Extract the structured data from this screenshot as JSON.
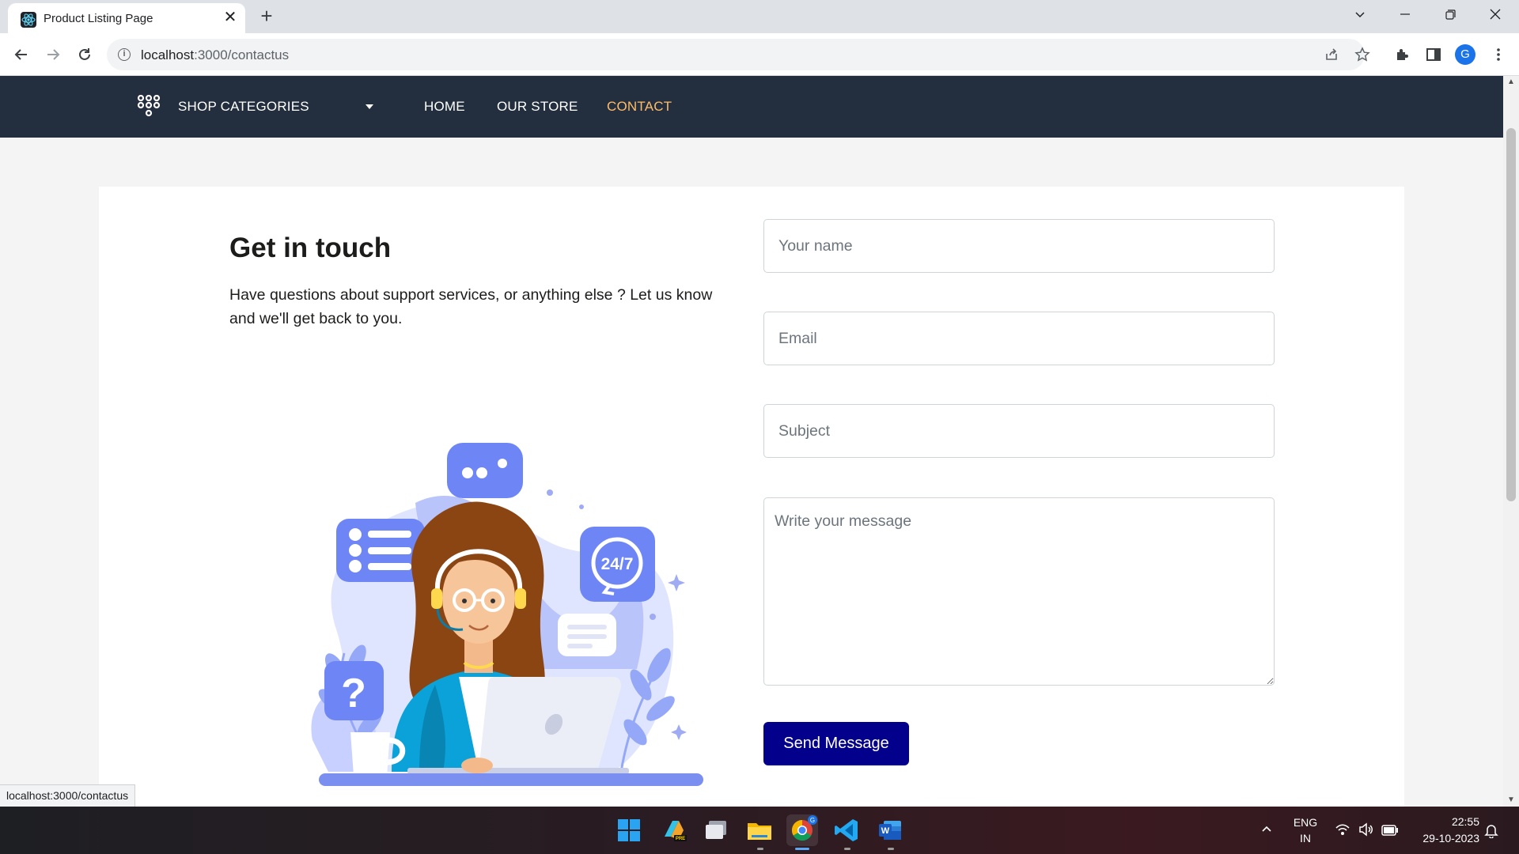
{
  "browser": {
    "tab_title": "Product Listing Page",
    "tab_close": "✕",
    "new_tab": "+",
    "url_host": "localhost",
    "url_rest": ":3000/contactus",
    "profile_initial": "G",
    "status_url": "localhost:3000/contactus",
    "icons": [
      "back-icon",
      "forward-icon",
      "reload-icon",
      "info-icon",
      "share-icon",
      "star-icon",
      "extensions-icon",
      "side-panel-icon",
      "menu-icon"
    ]
  },
  "site_nav": {
    "categories_label": "SHOP CATEGORIES",
    "links": [
      "HOME",
      "OUR STORE",
      "CONTACT"
    ],
    "active_link": "CONTACT",
    "active_color": "#febd69",
    "background": "#232f3e"
  },
  "contact": {
    "heading": "Get in touch",
    "description": "Have questions about support services, or anything else ? Let us know and we'll get back to you.",
    "illustration_badge": "24/7",
    "form": {
      "name_placeholder": "Your name",
      "email_placeholder": "Email",
      "subject_placeholder": "Subject",
      "message_placeholder": "Write your message",
      "submit_label": "Send Message",
      "submit_color": "#03008b"
    }
  },
  "taskbar": {
    "apps": [
      "start-icon",
      "clipchamp-icon",
      "task-view-icon",
      "file-explorer-icon",
      "chrome-icon",
      "vscode-icon",
      "word-icon"
    ],
    "language_line1": "ENG",
    "language_line2": "IN",
    "time": "22:55",
    "date": "29-10-2023"
  }
}
